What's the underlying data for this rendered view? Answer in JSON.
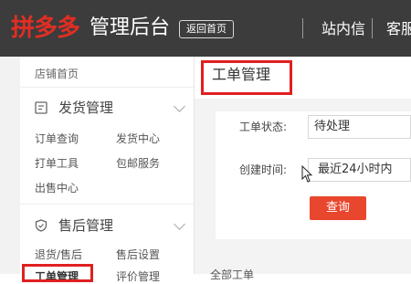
{
  "header": {
    "logo_text": "拼多多",
    "title": "管理后台",
    "return_button": "返回首页",
    "messages_link": "站内信",
    "service_link": "客服"
  },
  "sidebar": {
    "top_link": "店铺首页",
    "sections": [
      {
        "title": "发货管理",
        "icon": "shipping-icon",
        "items": [
          "订单查询",
          "发货中心",
          "打单工具",
          "包邮服务",
          "出售中心"
        ]
      },
      {
        "title": "售后管理",
        "icon": "shield-icon",
        "items": [
          "退货/售后",
          "售后设置",
          "工单管理",
          "评价管理"
        ]
      }
    ]
  },
  "main": {
    "page_title": "工单管理",
    "filters": {
      "status_label": "工单状态:",
      "status_value": "待处理",
      "time_label": "创建时间:",
      "time_value": "最近24小时内"
    },
    "query_button": "查询",
    "bottom_text": "全部工单"
  },
  "colors": {
    "brand_red": "#e02e24",
    "topbar": "#3c3c3c",
    "query_button": "#e8462d",
    "annotation_red": "#e02020"
  }
}
